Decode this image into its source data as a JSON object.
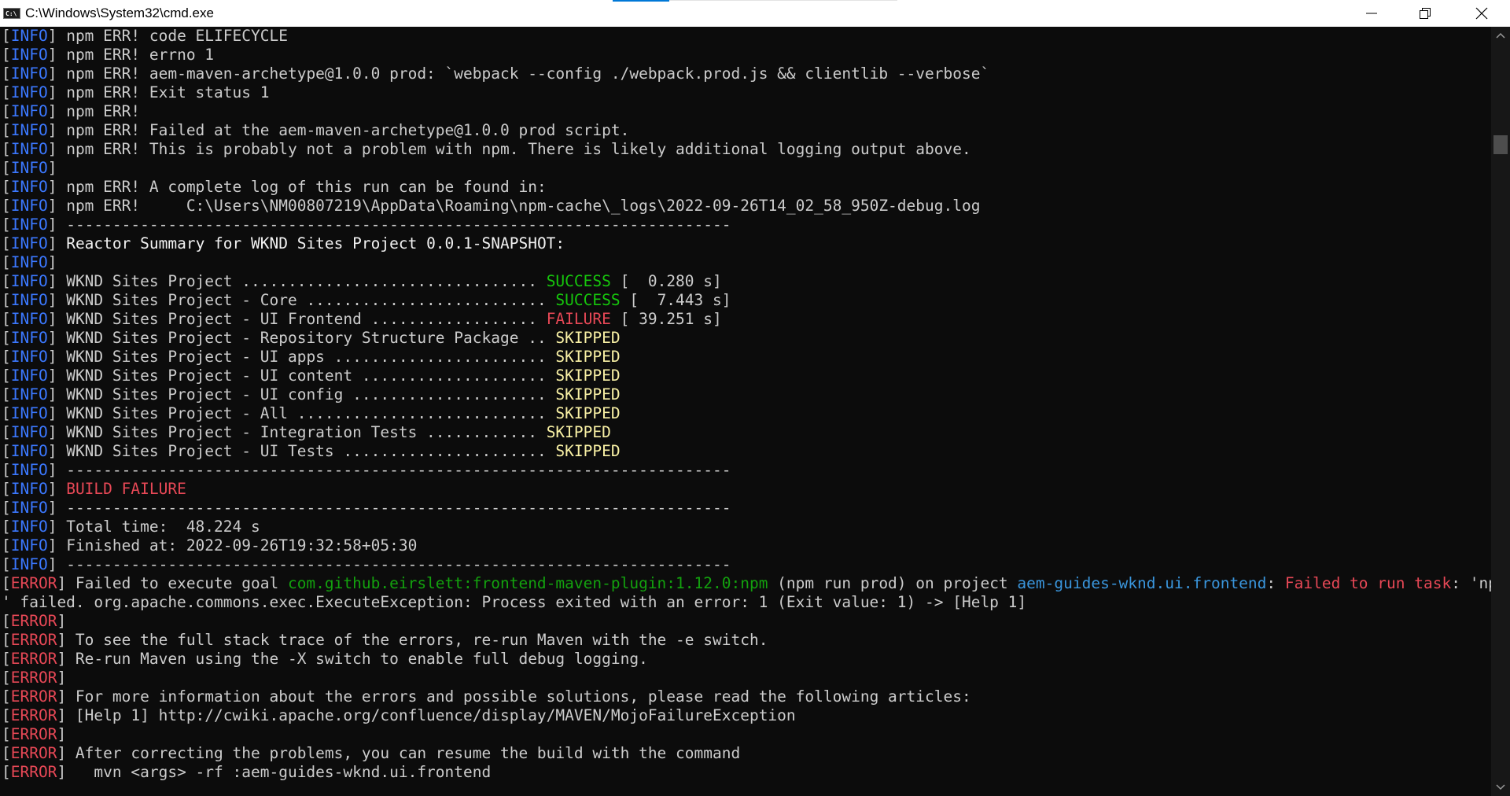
{
  "window": {
    "title": "C:\\Windows\\System32\\cmd.exe",
    "icon": "cmd-icon",
    "controls": [
      "minimize",
      "restore",
      "close"
    ]
  },
  "console": {
    "lines": [
      [
        {
          "t": "[",
          "c": "g"
        },
        {
          "t": "INFO",
          "c": "i"
        },
        {
          "t": "] npm ERR! code ELIFECYCLE",
          "c": "g"
        }
      ],
      [
        {
          "t": "[",
          "c": "g"
        },
        {
          "t": "INFO",
          "c": "i"
        },
        {
          "t": "] npm ERR! errno 1",
          "c": "g"
        }
      ],
      [
        {
          "t": "[",
          "c": "g"
        },
        {
          "t": "INFO",
          "c": "i"
        },
        {
          "t": "] npm ERR! aem-maven-archetype@1.0.0 prod: `webpack --config ./webpack.prod.js && clientlib --verbose`",
          "c": "g"
        }
      ],
      [
        {
          "t": "[",
          "c": "g"
        },
        {
          "t": "INFO",
          "c": "i"
        },
        {
          "t": "] npm ERR! Exit status 1",
          "c": "g"
        }
      ],
      [
        {
          "t": "[",
          "c": "g"
        },
        {
          "t": "INFO",
          "c": "i"
        },
        {
          "t": "] npm ERR!",
          "c": "g"
        }
      ],
      [
        {
          "t": "[",
          "c": "g"
        },
        {
          "t": "INFO",
          "c": "i"
        },
        {
          "t": "] npm ERR! Failed at the aem-maven-archetype@1.0.0 prod script.",
          "c": "g"
        }
      ],
      [
        {
          "t": "[",
          "c": "g"
        },
        {
          "t": "INFO",
          "c": "i"
        },
        {
          "t": "] npm ERR! This is probably not a problem with npm. There is likely additional logging output above.",
          "c": "g"
        }
      ],
      [
        {
          "t": "[",
          "c": "g"
        },
        {
          "t": "INFO",
          "c": "i"
        },
        {
          "t": "]",
          "c": "g"
        }
      ],
      [
        {
          "t": "[",
          "c": "g"
        },
        {
          "t": "INFO",
          "c": "i"
        },
        {
          "t": "] npm ERR! A complete log of this run can be found in:",
          "c": "g"
        }
      ],
      [
        {
          "t": "[",
          "c": "g"
        },
        {
          "t": "INFO",
          "c": "i"
        },
        {
          "t": "] npm ERR!     C:\\Users\\NM00807219\\AppData\\Roaming\\npm-cache\\_logs\\2022-09-26T14_02_58_950Z-debug.log",
          "c": "g"
        }
      ],
      [
        {
          "t": "[",
          "c": "g"
        },
        {
          "t": "INFO",
          "c": "i"
        },
        {
          "t": "] ------------------------------------------------------------------------",
          "c": "g"
        }
      ],
      [
        {
          "t": "[",
          "c": "g"
        },
        {
          "t": "INFO",
          "c": "i"
        },
        {
          "t": "] ",
          "c": "g"
        },
        {
          "t": "Reactor Summary for WKND Sites Project 0.0.1-SNAPSHOT:",
          "c": "w"
        }
      ],
      [
        {
          "t": "[",
          "c": "g"
        },
        {
          "t": "INFO",
          "c": "i"
        },
        {
          "t": "]",
          "c": "g"
        }
      ],
      [
        {
          "t": "[",
          "c": "g"
        },
        {
          "t": "INFO",
          "c": "i"
        },
        {
          "t": "] WKND Sites Project ................................ ",
          "c": "g"
        },
        {
          "t": "SUCCESS",
          "c": "s"
        },
        {
          "t": " [  0.280 s]",
          "c": "g"
        }
      ],
      [
        {
          "t": "[",
          "c": "g"
        },
        {
          "t": "INFO",
          "c": "i"
        },
        {
          "t": "] WKND Sites Project - Core .......................... ",
          "c": "g"
        },
        {
          "t": "SUCCESS",
          "c": "s"
        },
        {
          "t": " [  7.443 s]",
          "c": "g"
        }
      ],
      [
        {
          "t": "[",
          "c": "g"
        },
        {
          "t": "INFO",
          "c": "i"
        },
        {
          "t": "] WKND Sites Project - UI Frontend .................. ",
          "c": "g"
        },
        {
          "t": "FAILURE",
          "c": "r"
        },
        {
          "t": " [ 39.251 s]",
          "c": "g"
        }
      ],
      [
        {
          "t": "[",
          "c": "g"
        },
        {
          "t": "INFO",
          "c": "i"
        },
        {
          "t": "] WKND Sites Project - Repository Structure Package .. ",
          "c": "g"
        },
        {
          "t": "SKIPPED",
          "c": "y"
        }
      ],
      [
        {
          "t": "[",
          "c": "g"
        },
        {
          "t": "INFO",
          "c": "i"
        },
        {
          "t": "] WKND Sites Project - UI apps ....................... ",
          "c": "g"
        },
        {
          "t": "SKIPPED",
          "c": "y"
        }
      ],
      [
        {
          "t": "[",
          "c": "g"
        },
        {
          "t": "INFO",
          "c": "i"
        },
        {
          "t": "] WKND Sites Project - UI content .................... ",
          "c": "g"
        },
        {
          "t": "SKIPPED",
          "c": "y"
        }
      ],
      [
        {
          "t": "[",
          "c": "g"
        },
        {
          "t": "INFO",
          "c": "i"
        },
        {
          "t": "] WKND Sites Project - UI config ..................... ",
          "c": "g"
        },
        {
          "t": "SKIPPED",
          "c": "y"
        }
      ],
      [
        {
          "t": "[",
          "c": "g"
        },
        {
          "t": "INFO",
          "c": "i"
        },
        {
          "t": "] WKND Sites Project - All ........................... ",
          "c": "g"
        },
        {
          "t": "SKIPPED",
          "c": "y"
        }
      ],
      [
        {
          "t": "[",
          "c": "g"
        },
        {
          "t": "INFO",
          "c": "i"
        },
        {
          "t": "] WKND Sites Project - Integration Tests ............ ",
          "c": "g"
        },
        {
          "t": "SKIPPED",
          "c": "y"
        }
      ],
      [
        {
          "t": "[",
          "c": "g"
        },
        {
          "t": "INFO",
          "c": "i"
        },
        {
          "t": "] WKND Sites Project - UI Tests ...................... ",
          "c": "g"
        },
        {
          "t": "SKIPPED",
          "c": "y"
        }
      ],
      [
        {
          "t": "[",
          "c": "g"
        },
        {
          "t": "INFO",
          "c": "i"
        },
        {
          "t": "] ------------------------------------------------------------------------",
          "c": "g"
        }
      ],
      [
        {
          "t": "[",
          "c": "g"
        },
        {
          "t": "INFO",
          "c": "i"
        },
        {
          "t": "] ",
          "c": "g"
        },
        {
          "t": "BUILD FAILURE",
          "c": "r"
        }
      ],
      [
        {
          "t": "[",
          "c": "g"
        },
        {
          "t": "INFO",
          "c": "i"
        },
        {
          "t": "] ------------------------------------------------------------------------",
          "c": "g"
        }
      ],
      [
        {
          "t": "[",
          "c": "g"
        },
        {
          "t": "INFO",
          "c": "i"
        },
        {
          "t": "] Total time:  48.224 s",
          "c": "g"
        }
      ],
      [
        {
          "t": "[",
          "c": "g"
        },
        {
          "t": "INFO",
          "c": "i"
        },
        {
          "t": "] Finished at: 2022-09-26T19:32:58+05:30",
          "c": "g"
        }
      ],
      [
        {
          "t": "[",
          "c": "g"
        },
        {
          "t": "INFO",
          "c": "i"
        },
        {
          "t": "] ------------------------------------------------------------------------",
          "c": "g"
        }
      ],
      [
        {
          "t": "[",
          "c": "g"
        },
        {
          "t": "ERROR",
          "c": "e"
        },
        {
          "t": "] Failed to execute goal ",
          "c": "g"
        },
        {
          "t": "com.github.eirslett:frontend-maven-plugin:1.12.0:npm",
          "c": "dg"
        },
        {
          "t": " (npm run prod) on project ",
          "c": "g"
        },
        {
          "t": "aem-guides-wknd.ui.frontend",
          "c": "cy"
        },
        {
          "t": ": ",
          "c": "g"
        },
        {
          "t": "Failed to run task",
          "c": "r"
        },
        {
          "t": ": 'npm run prod",
          "c": "g"
        }
      ],
      [
        {
          "t": "' failed. org.apache.commons.exec.ExecuteException: Process exited with an error: 1 (Exit value: 1) -> [Help 1]",
          "c": "g"
        }
      ],
      [
        {
          "t": "[",
          "c": "g"
        },
        {
          "t": "ERROR",
          "c": "e"
        },
        {
          "t": "]",
          "c": "g"
        }
      ],
      [
        {
          "t": "[",
          "c": "g"
        },
        {
          "t": "ERROR",
          "c": "e"
        },
        {
          "t": "] To see the full stack trace of the errors, re-run Maven with the -e switch.",
          "c": "g"
        }
      ],
      [
        {
          "t": "[",
          "c": "g"
        },
        {
          "t": "ERROR",
          "c": "e"
        },
        {
          "t": "] Re-run Maven using the -X switch to enable full debug logging.",
          "c": "g"
        }
      ],
      [
        {
          "t": "[",
          "c": "g"
        },
        {
          "t": "ERROR",
          "c": "e"
        },
        {
          "t": "]",
          "c": "g"
        }
      ],
      [
        {
          "t": "[",
          "c": "g"
        },
        {
          "t": "ERROR",
          "c": "e"
        },
        {
          "t": "] For more information about the errors and possible solutions, please read the following articles:",
          "c": "g"
        }
      ],
      [
        {
          "t": "[",
          "c": "g"
        },
        {
          "t": "ERROR",
          "c": "e"
        },
        {
          "t": "] [Help 1] http://cwiki.apache.org/confluence/display/MAVEN/MojoFailureException",
          "c": "g"
        }
      ],
      [
        {
          "t": "[",
          "c": "g"
        },
        {
          "t": "ERROR",
          "c": "e"
        },
        {
          "t": "]",
          "c": "g"
        }
      ],
      [
        {
          "t": "[",
          "c": "g"
        },
        {
          "t": "ERROR",
          "c": "e"
        },
        {
          "t": "] After correcting the problems, you can resume the build with the command",
          "c": "g"
        }
      ],
      [
        {
          "t": "[",
          "c": "g"
        },
        {
          "t": "ERROR",
          "c": "e"
        },
        {
          "t": "]   mvn <args> -rf :aem-guides-wknd.ui.frontend",
          "c": "g"
        }
      ]
    ]
  },
  "colors": {
    "background": "#0c0c0c",
    "text": "#cccccc",
    "info": "#3b78ff",
    "error": "#e74856",
    "success": "#16c60c",
    "skipped": "#f9f1a5",
    "link_green": "#13a10e",
    "link_cyan": "#3a96dd"
  }
}
